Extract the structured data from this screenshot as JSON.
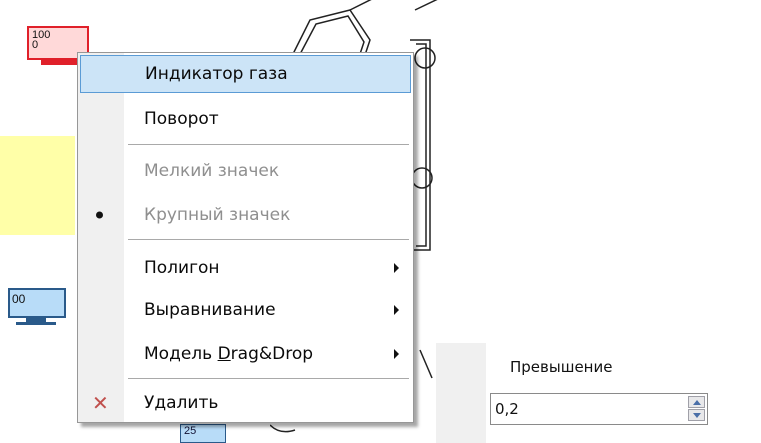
{
  "canvas": {
    "gas_sensor_value_top": "100",
    "gas_sensor_value_bottom": "0",
    "monitor_value": "00",
    "small_box_value": "25"
  },
  "context_menu": {
    "items": [
      {
        "label": "Индикатор газа",
        "state": "highlighted"
      },
      {
        "label": "Поворот",
        "state": "enabled"
      },
      {
        "label": "Мелкий значек",
        "state": "disabled"
      },
      {
        "label": "Крупный значек",
        "state": "disabled",
        "checked": true
      },
      {
        "label": "Полигон",
        "state": "enabled",
        "submenu": true
      },
      {
        "label": "Выравнивание",
        "state": "enabled",
        "submenu": true
      },
      {
        "label_before": "Модель ",
        "label_accel": "D",
        "label_after": "rag&Drop",
        "state": "enabled",
        "submenu": true
      },
      {
        "label": "Удалить",
        "state": "enabled",
        "icon": "delete-x-icon"
      }
    ]
  },
  "properties_panel": {
    "label": "Превышение",
    "value": "0,2"
  },
  "colors": {
    "menu_highlight": "#cce4f7",
    "menu_highlight_border": "#5b9bd5",
    "delete_icon": "#c0504d",
    "sensor_border": "#e0202a"
  }
}
